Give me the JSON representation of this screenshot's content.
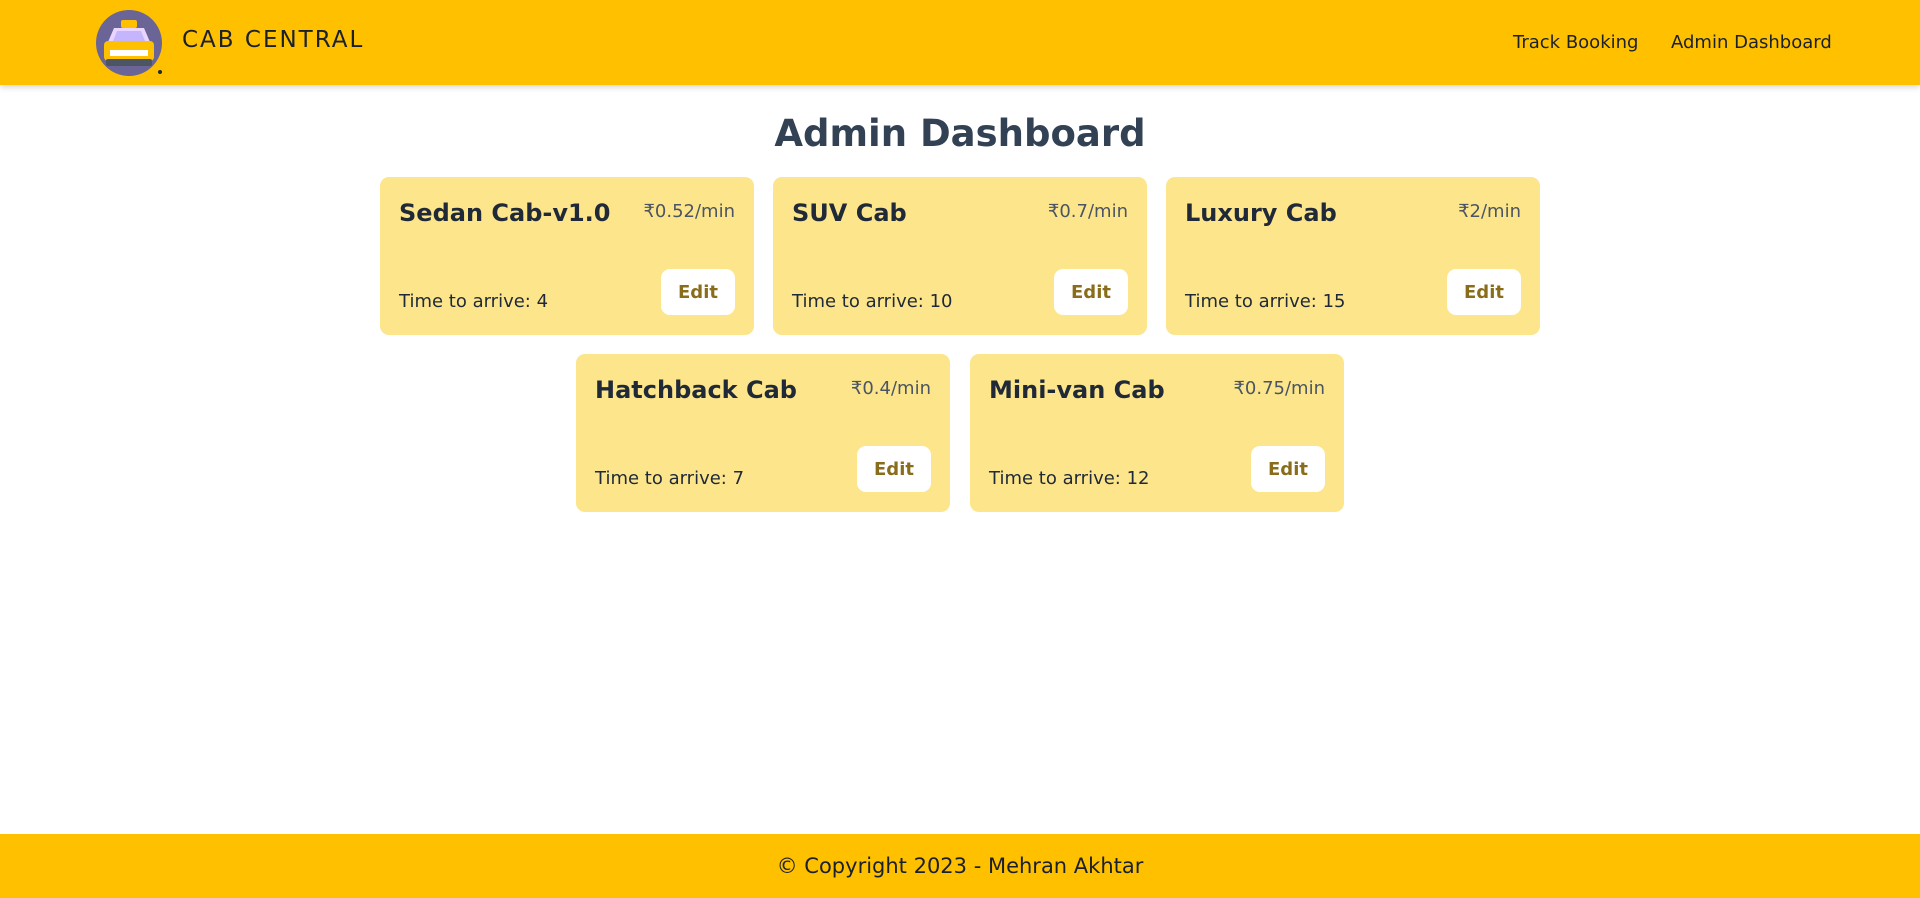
{
  "header": {
    "brand": "CAB CENTRAL",
    "logo_icon": "taxi-icon",
    "nav": [
      {
        "label": "Track Booking"
      },
      {
        "label": "Admin Dashboard"
      }
    ]
  },
  "main": {
    "title": "Admin Dashboard",
    "cabs": [
      {
        "name": "Sedan Cab-v1.0",
        "rate": "₹0.52/min",
        "time": "Time to arrive: 4",
        "edit_label": "Edit"
      },
      {
        "name": "SUV Cab",
        "rate": "₹0.7/min",
        "time": "Time to arrive: 10",
        "edit_label": "Edit"
      },
      {
        "name": "Luxury Cab",
        "rate": "₹2/min",
        "time": "Time to arrive: 15",
        "edit_label": "Edit"
      },
      {
        "name": "Hatchback Cab",
        "rate": "₹0.4/min",
        "time": "Time to arrive: 7",
        "edit_label": "Edit"
      },
      {
        "name": "Mini-van Cab",
        "rate": "₹0.75/min",
        "time": "Time to arrive: 12",
        "edit_label": "Edit"
      }
    ]
  },
  "footer": {
    "text": "© Copyright 2023 - Mehran Akhtar"
  },
  "colors": {
    "brand_yellow": "#ffc000",
    "card_bg": "#fce58b",
    "title": "#334155",
    "edit_text": "#8a6d1a",
    "logo_circle": "#6b6496"
  }
}
